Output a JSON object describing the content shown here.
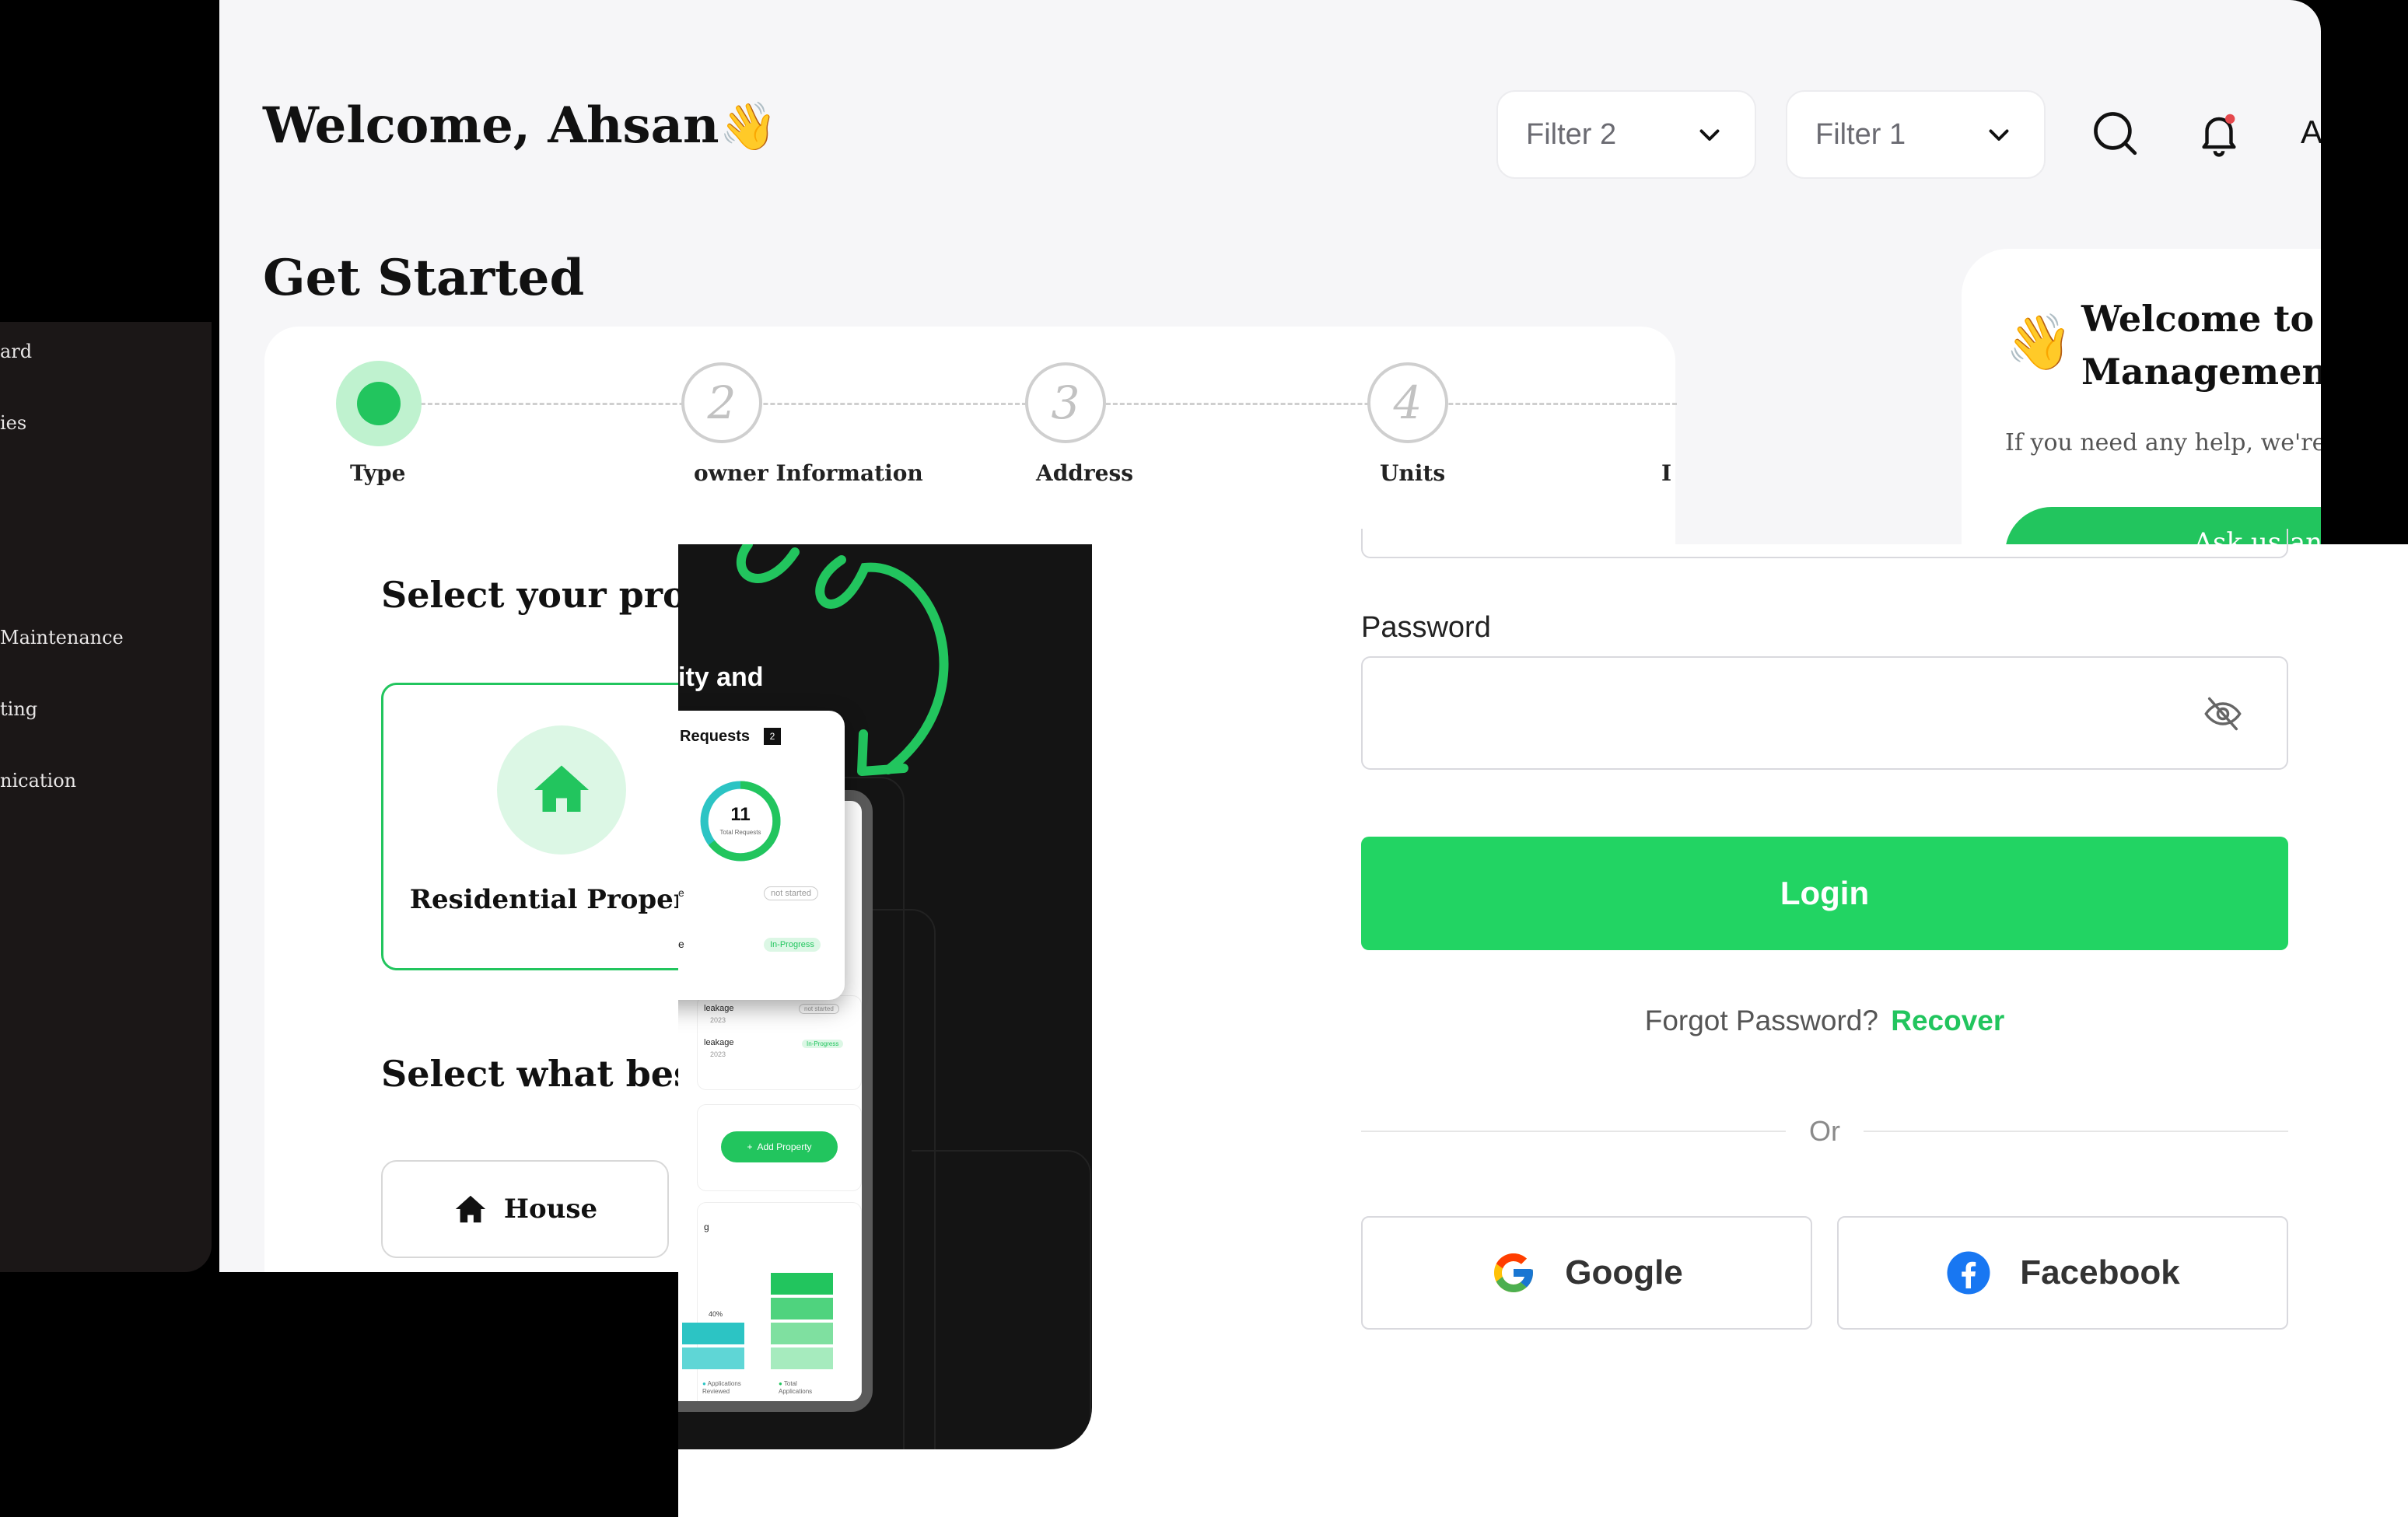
{
  "header": {
    "welcome": "Welcome, Ahsan",
    "welcome_emoji": "👋",
    "filters": [
      "Filter 2",
      "Filter 1"
    ],
    "avatar_initial": "A"
  },
  "get_started": {
    "title": "Get Started",
    "steps": [
      {
        "number": "",
        "label": "Type",
        "active": true
      },
      {
        "number": "2",
        "label": "owner Information"
      },
      {
        "number": "3",
        "label": "Address"
      },
      {
        "number": "4",
        "label": "Units"
      },
      {
        "number": "",
        "label": "I"
      }
    ],
    "select_property_heading": "Select your propert",
    "residential_label": "Residential Property",
    "select_best_heading": "Select what best de",
    "house_label": "House"
  },
  "help_card": {
    "emoji": "👋",
    "title_line1": "Welcome to Property",
    "title_line2": "Management system",
    "subtitle": "If you need any help, we're here to help yo",
    "button_label": "Ask us anything"
  },
  "sidebar": {
    "items": [
      "ard",
      "ies",
      "Maintenance",
      "ting",
      "nication"
    ]
  },
  "promo": {
    "heading": "ity and",
    "requests_label": "Requests",
    "requests_badge": "2",
    "total_requests_value": "11",
    "total_requests_label": "Total Requests",
    "row_letter_1": "e",
    "row_letter_2": "e",
    "status_not_started": "not started",
    "status_in_progress": "In-Progress",
    "leakage_1": "leakage",
    "leakage_1_date": "2023",
    "leakage_2": "leakage",
    "leakage_2_date": "2023",
    "add_property": "Add Property",
    "chart_label": "g",
    "chart_percent": "40%",
    "legend_1a": "Applications",
    "legend_1b": "Reviewed",
    "legend_2a": "Total",
    "legend_2b": "Applications",
    "colors": {
      "green": "#22c55e",
      "teal": "#2cc4c4"
    }
  },
  "login": {
    "password_label": "Password",
    "login_button": "Login",
    "forgot_text": "Forgot Password?",
    "recover_link": "Recover",
    "or_text": "Or",
    "google_label": "Google",
    "facebook_label": "Facebook",
    "accent": "#22d463"
  }
}
